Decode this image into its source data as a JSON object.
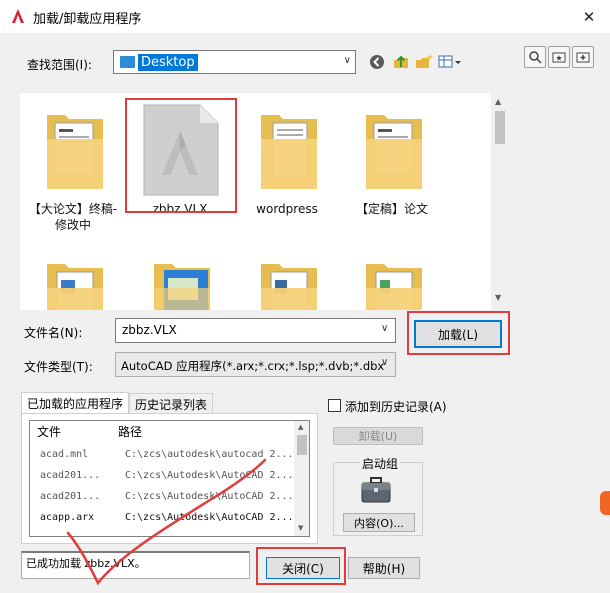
{
  "window": {
    "title": "加载/卸载应用程序",
    "close_glyph": "✕",
    "accent_color": "#0078d7",
    "annotation_color": "#e03c3c"
  },
  "lookin": {
    "label": "查找范围(I):",
    "value": "Desktop",
    "arrow": "∨"
  },
  "files": [
    {
      "name": "【大论文】终稿-修改中",
      "icon": "folder-icon"
    },
    {
      "name": "zbbz.VLX",
      "icon": "autocad-file-icon"
    },
    {
      "name": "wordpress",
      "icon": "folder-icon"
    },
    {
      "name": "【定稿】论文",
      "icon": "folder-icon"
    },
    {
      "name": "",
      "icon": "folder-icon"
    },
    {
      "name": "",
      "icon": "folder-icon"
    },
    {
      "name": "",
      "icon": "folder-icon"
    },
    {
      "name": "",
      "icon": "folder-icon"
    }
  ],
  "filename": {
    "label": "文件名(N):",
    "value": "zbbz.VLX",
    "arrow": "∨"
  },
  "filetype": {
    "label": "文件类型(T):",
    "value": "AutoCAD 应用程序(*.arx;*.crx;*.lsp;*.dvb;*.dbx",
    "arrow": "∨"
  },
  "buttons": {
    "load": "加载(L)",
    "unload": "卸载(U)",
    "contents": "内容(O)...",
    "close": "关闭(C)",
    "help": "帮助(H)"
  },
  "tabs": {
    "loaded": "已加载的应用程序",
    "history": "历史记录列表"
  },
  "apps_table": {
    "col_file": "文件",
    "col_path": "路径",
    "rows": [
      {
        "file": "acad.mnl",
        "path": "C:\\zcs\\autodesk\\autocad 2..."
      },
      {
        "file": "acad201...",
        "path": "C:\\zcs\\Autodesk\\AutoCAD 2..."
      },
      {
        "file": "acad201...",
        "path": "C:\\zcs\\Autodesk\\AutoCAD 2..."
      },
      {
        "file": "acapp.arx",
        "path": "C:\\zcs\\Autodesk\\AutoCAD 2..."
      }
    ]
  },
  "add_history_label": "添加到历史记录(A)",
  "startup_label": "启动组",
  "status_text": "已成功加载 zbbz.VLX。"
}
